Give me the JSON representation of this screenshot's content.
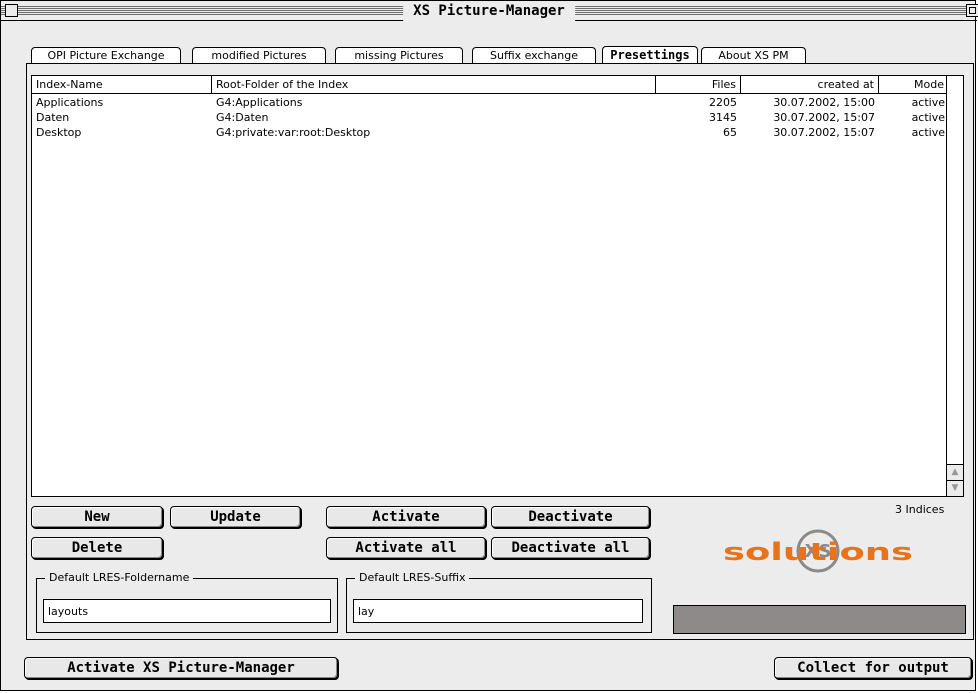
{
  "window": {
    "title": "XS Picture-Manager"
  },
  "tabs": [
    {
      "label": "OPI Picture Exchange"
    },
    {
      "label": "modified Pictures"
    },
    {
      "label": "missing Pictures"
    },
    {
      "label": "Suffix exchange"
    },
    {
      "label": "Presettings"
    },
    {
      "label": "About XS PM"
    }
  ],
  "list": {
    "columns": [
      "Index-Name",
      "Root-Folder of the Index",
      "Files",
      "created at",
      "Mode"
    ],
    "rows": [
      [
        "Applications",
        "G4:Applications",
        "2205",
        "30.07.2002, 15:00",
        "active"
      ],
      [
        "Daten",
        "G4:Daten",
        "3145",
        "30.07.2002, 15:07",
        "active"
      ],
      [
        "Desktop",
        "G4:private:var:root:Desktop",
        "65",
        "30.07.2002, 15:07",
        "active"
      ]
    ]
  },
  "buttons": {
    "new": "New",
    "update": "Update",
    "activate": "Activate",
    "deactivate": "Deactivate",
    "delete": "Delete",
    "activate_all": "Activate all",
    "deactivate_all": "Deactivate all",
    "activate_manager": "Activate XS Picture-Manager",
    "collect": "Collect for output"
  },
  "count_label": "3 Indices",
  "folder_group": {
    "legend": "Default LRES-Foldername",
    "value": "layouts"
  },
  "suffix_group": {
    "legend": "Default LRES-Suffix",
    "value": "lay"
  },
  "logo": {
    "text": "solutions",
    "mark": "XS",
    "colors": {
      "text": "#e8731a",
      "mark": "#8a8a8a"
    }
  }
}
